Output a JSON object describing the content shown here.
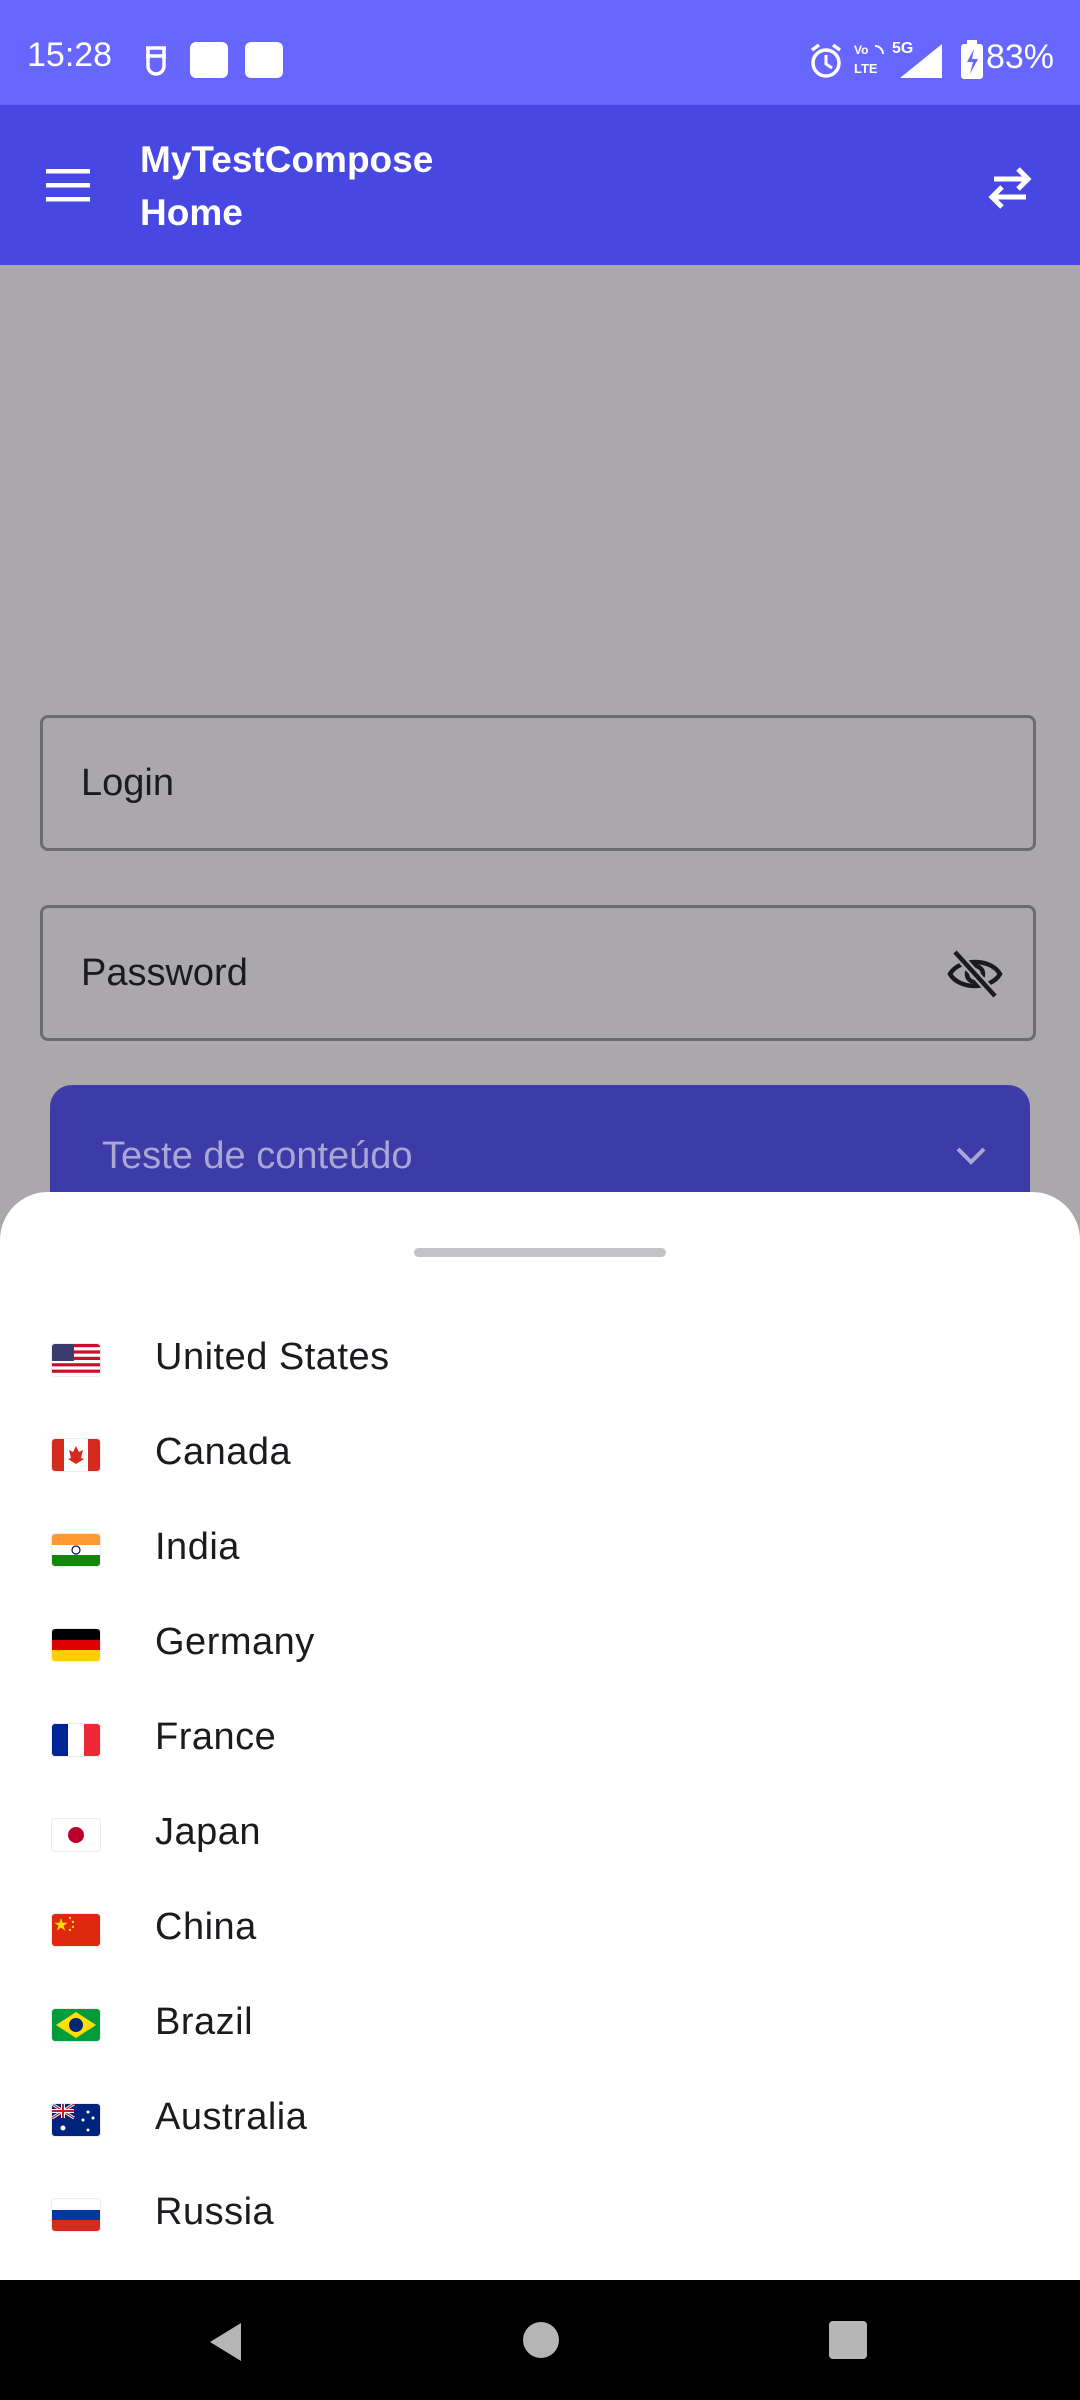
{
  "status_bar": {
    "time": "15:28",
    "battery": "83%",
    "icons": [
      "alarm-icon",
      "volte-icon",
      "5g-icon",
      "signal-icon",
      "battery-charging-icon"
    ],
    "bg_color": "#6766ff"
  },
  "app_bar": {
    "title_line1": "MyTestCompose",
    "title_line2": "Home",
    "bg_color": "#4747e2"
  },
  "form": {
    "login_placeholder": "Login",
    "password_placeholder": "Password",
    "dropdown_label": "Teste de conteúdo",
    "dropdown_color": "#3d3ba8"
  },
  "sheet": {
    "countries": [
      {
        "name": "United States",
        "flag": "us-flag-icon"
      },
      {
        "name": "Canada",
        "flag": "ca-flag-icon"
      },
      {
        "name": "India",
        "flag": "in-flag-icon"
      },
      {
        "name": "Germany",
        "flag": "de-flag-icon"
      },
      {
        "name": "France",
        "flag": "fr-flag-icon"
      },
      {
        "name": "Japan",
        "flag": "jp-flag-icon"
      },
      {
        "name": "China",
        "flag": "cn-flag-icon"
      },
      {
        "name": "Brazil",
        "flag": "br-flag-icon"
      },
      {
        "name": "Australia",
        "flag": "au-flag-icon"
      },
      {
        "name": "Russia",
        "flag": "ru-flag-icon"
      }
    ]
  }
}
